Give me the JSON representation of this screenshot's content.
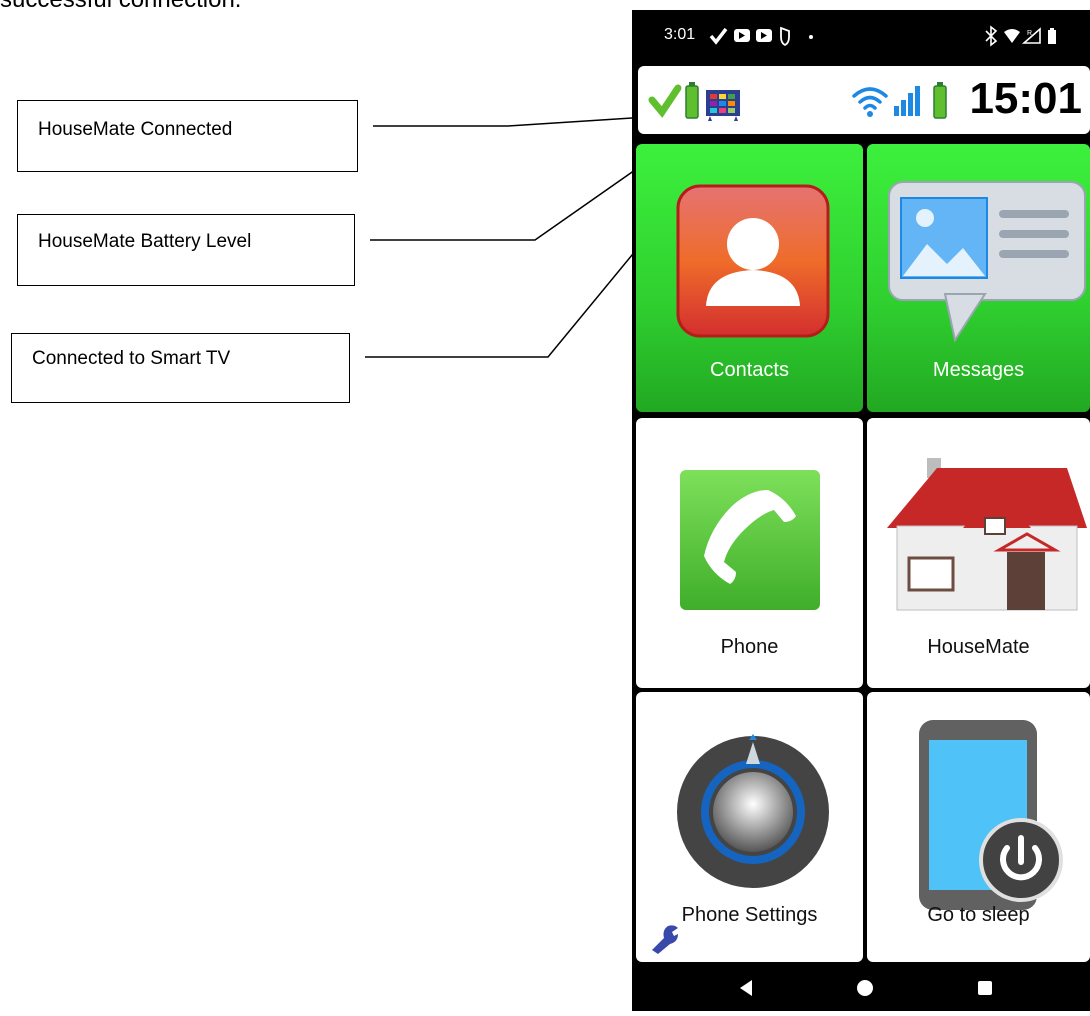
{
  "page_top_text": "successful connection.",
  "callouts": [
    {
      "label": "HouseMate Connected"
    },
    {
      "label": "HouseMate Battery Level"
    },
    {
      "label": "Connected to Smart TV"
    }
  ],
  "statusbar": {
    "time": "3:01"
  },
  "appbar": {
    "clock": "15:01"
  },
  "tiles": [
    {
      "label": "Contacts"
    },
    {
      "label": "Messages"
    },
    {
      "label": "Phone"
    },
    {
      "label": "HouseMate"
    },
    {
      "label": "Phone Settings"
    },
    {
      "label": "Go to sleep"
    }
  ],
  "colors": {
    "tile_green": "#2fd12f",
    "phone_frame": "#000000",
    "wifi_blue": "#1e88e5",
    "battery_green": "#43a047"
  },
  "icons": [
    "check-icon",
    "battery-icon",
    "smart-tv-icon",
    "wifi-icon",
    "signal-icon",
    "contacts-icon",
    "messages-icon",
    "phone-icon",
    "housemate-icon",
    "settings-knob-icon",
    "sleep-icon",
    "wrench-icon",
    "back-icon",
    "home-icon",
    "recents-icon"
  ]
}
